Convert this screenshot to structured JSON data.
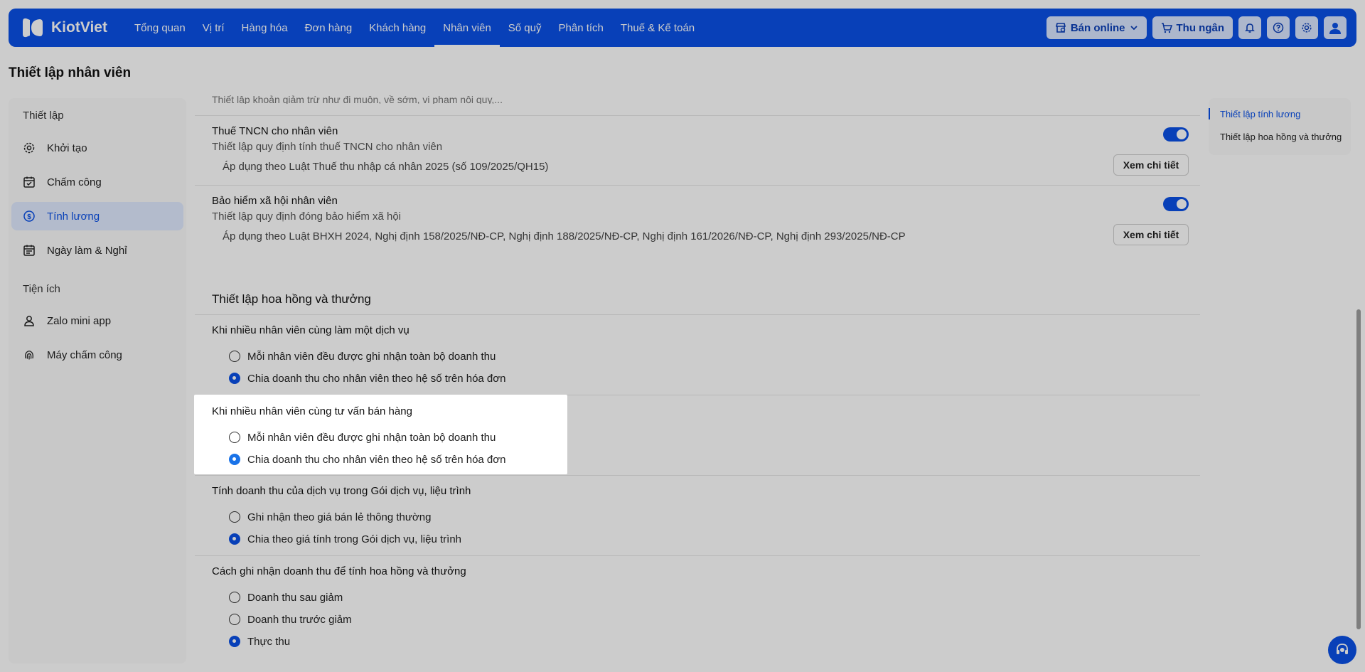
{
  "brand": {
    "name": "KiotViet"
  },
  "nav": {
    "items": [
      "Tổng quan",
      "Vị trí",
      "Hàng hóa",
      "Đơn hàng",
      "Khách hàng",
      "Nhân viên",
      "Số quỹ",
      "Phân tích",
      "Thuế & Kế toán"
    ],
    "active": "Nhân viên",
    "ban_online": "Bán online",
    "thu_ngan": "Thu ngân"
  },
  "page": {
    "title": "Thiết lập nhân viên"
  },
  "sidebar": {
    "section1": "Thiết lập",
    "items1": [
      {
        "label": "Khởi tạo",
        "icon": "gear-icon"
      },
      {
        "label": "Chấm công",
        "icon": "calendar-check-icon"
      },
      {
        "label": "Tính lương",
        "icon": "dollar-circle-icon",
        "active": true
      },
      {
        "label": "Ngày làm & Nghỉ",
        "icon": "calendar-icon"
      }
    ],
    "section2": "Tiện ích",
    "items2": [
      {
        "label": "Zalo mini app",
        "icon": "user-icon"
      },
      {
        "label": "Máy chấm công",
        "icon": "fingerprint-icon"
      }
    ]
  },
  "card1": {
    "cut_text": "Thiết lập khoản giảm trừ như đi muộn, về sớm, vi phạm nội quy,...",
    "rows": [
      {
        "title": "Thuế TNCN cho nhân viên",
        "desc": "Thiết lập quy định tính thuế TNCN cho nhân viên",
        "note": "Áp dụng theo Luật Thuế thu nhập cá nhân 2025 (số 109/2025/QH15)",
        "button": "Xem chi tiết",
        "enabled": true
      },
      {
        "title": "Bảo hiểm xã hội nhân viên",
        "desc": "Thiết lập quy định đóng bảo hiểm xã hội",
        "note": "Áp dụng theo Luật BHXH 2024, Nghị định 158/2025/NĐ-CP, Nghị định 188/2025/NĐ-CP, Nghị định 161/2026/NĐ-CP, Nghị định 293/2025/NĐ-CP",
        "button": "Xem chi tiết",
        "enabled": true
      }
    ]
  },
  "card2": {
    "title": "Thiết lập hoa hồng và thưởng",
    "questions": [
      {
        "title": "Khi nhiều nhân viên cùng làm một dịch vụ",
        "options": [
          "Mỗi nhân viên đều được ghi nhận toàn bộ doanh thu",
          "Chia doanh thu cho nhân viên theo hệ số trên hóa đơn"
        ],
        "selected": 1
      },
      {
        "title": "Khi nhiều nhân viên cùng tư vấn bán hàng",
        "options": [
          "Mỗi nhân viên đều được ghi nhận toàn bộ doanh thu",
          "Chia doanh thu cho nhân viên theo hệ số trên hóa đơn"
        ],
        "selected": 1
      },
      {
        "title": "Tính doanh thu của dịch vụ trong Gói dịch vụ, liệu trình",
        "options": [
          "Ghi nhận theo giá bán lẻ thông thường",
          "Chia theo giá tính trong Gói dịch vụ, liệu trình"
        ],
        "selected": 1
      },
      {
        "title": "Cách ghi nhận doanh thu để tính hoa hồng và thưởng",
        "options": [
          "Doanh thu sau giảm",
          "Doanh thu trước giảm",
          "Thực thu"
        ],
        "selected": 2
      }
    ]
  },
  "anchor": {
    "items": [
      "Thiết lập tính lương",
      "Thiết lập hoa hồng và thưởng"
    ],
    "active": 0
  },
  "colors": {
    "primary": "#0b51e7",
    "active_bg": "#e0eaff"
  }
}
